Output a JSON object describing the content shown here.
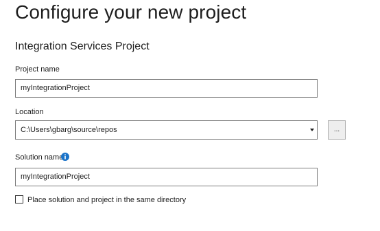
{
  "page": {
    "title": "Configure your new project",
    "subtitle": "Integration Services Project"
  },
  "project_name": {
    "label": "Project name",
    "value": "myIntegrationProject"
  },
  "location": {
    "label": "Location",
    "value": "C:\\Users\\gbarg\\source\\repos",
    "browse_label": "..."
  },
  "solution_name": {
    "label": "Solution name",
    "value": "myIntegrationProject"
  },
  "same_directory": {
    "label": "Place solution and project in the same directory",
    "checked": false
  },
  "colors": {
    "info_icon": "#1a73c9",
    "border": "#7a7a7a"
  }
}
